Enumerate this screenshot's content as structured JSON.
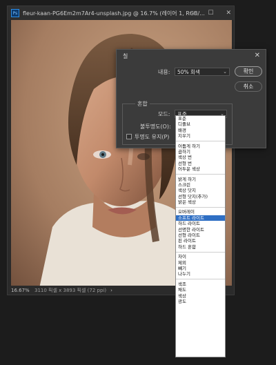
{
  "document": {
    "title": "fleur-kaan-PG6Em2m7Ar4-unsplash.jpg @ 16.7% (레이어 1, RGB/...",
    "ps_badge": "Ps",
    "controls": {
      "minimize": "—",
      "maximize": "☐",
      "close": "✕"
    },
    "status": {
      "zoom": "16.67%",
      "info": "3110 픽셀 x 3893 픽셀 (72 ppi)",
      "arrow": "›"
    }
  },
  "dialog": {
    "title": "칠",
    "close": "✕",
    "contents_label": "내용:",
    "contents_value": "50% 회색",
    "ok_label": "확인",
    "cancel_label": "취소",
    "blending_group": "혼합",
    "mode_label": "모드:",
    "mode_value": "표준",
    "opacity_label": "불투명도(O):",
    "preserve_label": "투명도 유지(P)"
  },
  "blend_modes": [
    [
      "표준",
      "디졸브",
      "배경",
      "지우기"
    ],
    [
      "어둡게 하기",
      "곱하기",
      "색상 번",
      "선형 번",
      "어두운 색상"
    ],
    [
      "밝게 하기",
      "스크린",
      "색상 닷지",
      "선형 닷지(추가)",
      "밝은 색상"
    ],
    [
      "오버레이",
      "소프트 라이트",
      "하드 라이트",
      "선명한 라이트",
      "선형 라이트",
      "핀 라이트",
      "하드 혼합"
    ],
    [
      "차이",
      "제외",
      "빼기",
      "나누기"
    ],
    [
      "색조",
      "채도",
      "색상",
      "광도"
    ]
  ],
  "selected_mode": "소프트 라이트",
  "icons": {
    "dropdown": "chevron-down-icon"
  }
}
